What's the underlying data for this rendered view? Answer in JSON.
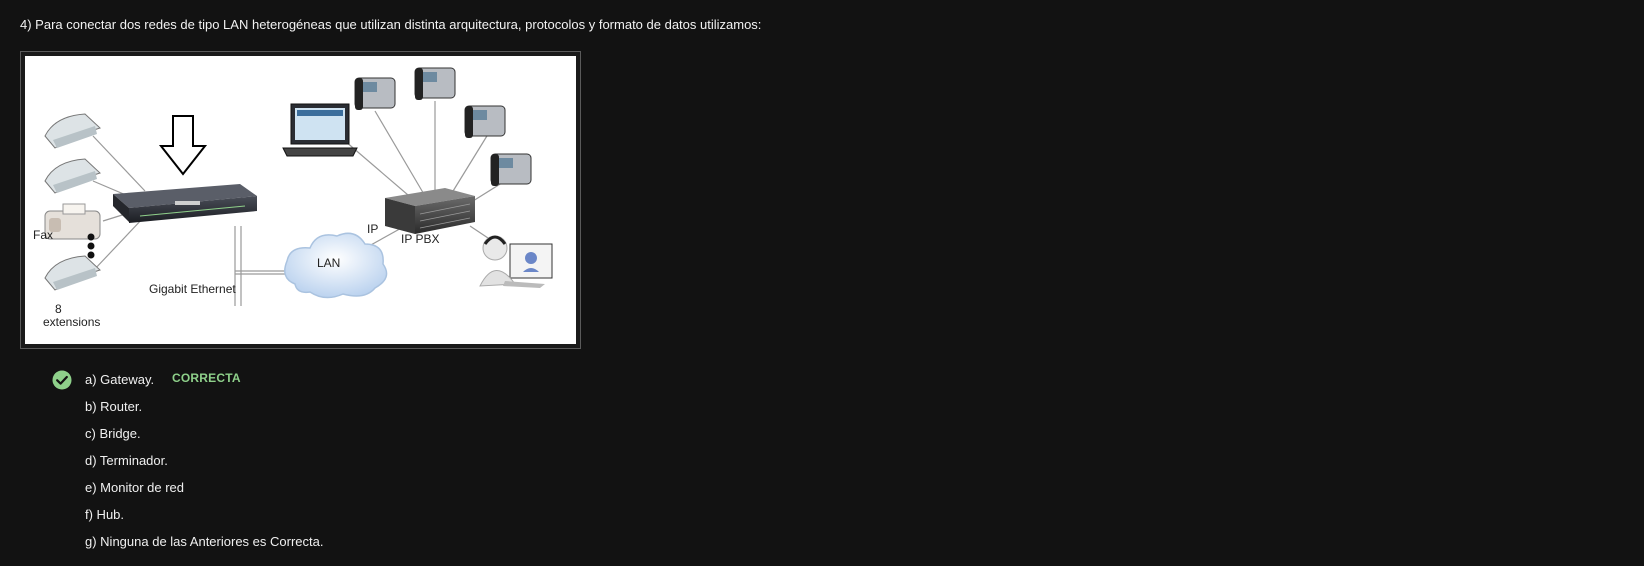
{
  "question": {
    "text": "4) Para conectar dos redes de tipo LAN heterogéneas que utilizan distinta arquitectura, protocolos y formato de datos utilizamos:"
  },
  "figure": {
    "labels": {
      "fax": "Fax",
      "extensions_count": "8",
      "extensions": "extensions",
      "gigabit": "Gigabit Ethernet",
      "lan": "LAN",
      "ip": "IP",
      "ip_pbx": "IP PBX"
    }
  },
  "answers": [
    {
      "label": "a) Gateway.",
      "correct": true
    },
    {
      "label": "b) Router.",
      "correct": false
    },
    {
      "label": "c) Bridge.",
      "correct": false
    },
    {
      "label": "d) Terminador.",
      "correct": false
    },
    {
      "label": "e) Monitor de red",
      "correct": false
    },
    {
      "label": "f) Hub.",
      "correct": false
    },
    {
      "label": "g) Ninguna de las Anteriores es Correcta.",
      "correct": false
    }
  ],
  "result": {
    "correct_label": "CORRECTA"
  },
  "colors": {
    "background": "#121212",
    "correct": "#8ed08a"
  },
  "icons": {
    "check": "check-circle-icon",
    "arrow": "down-arrow-icon",
    "phone": "desk-phone-icon",
    "fax": "fax-icon",
    "gateway": "gateway-device-icon",
    "server": "server-icon",
    "laptop": "laptop-icon",
    "cloud": "cloud-icon",
    "agent": "headset-user-icon"
  }
}
